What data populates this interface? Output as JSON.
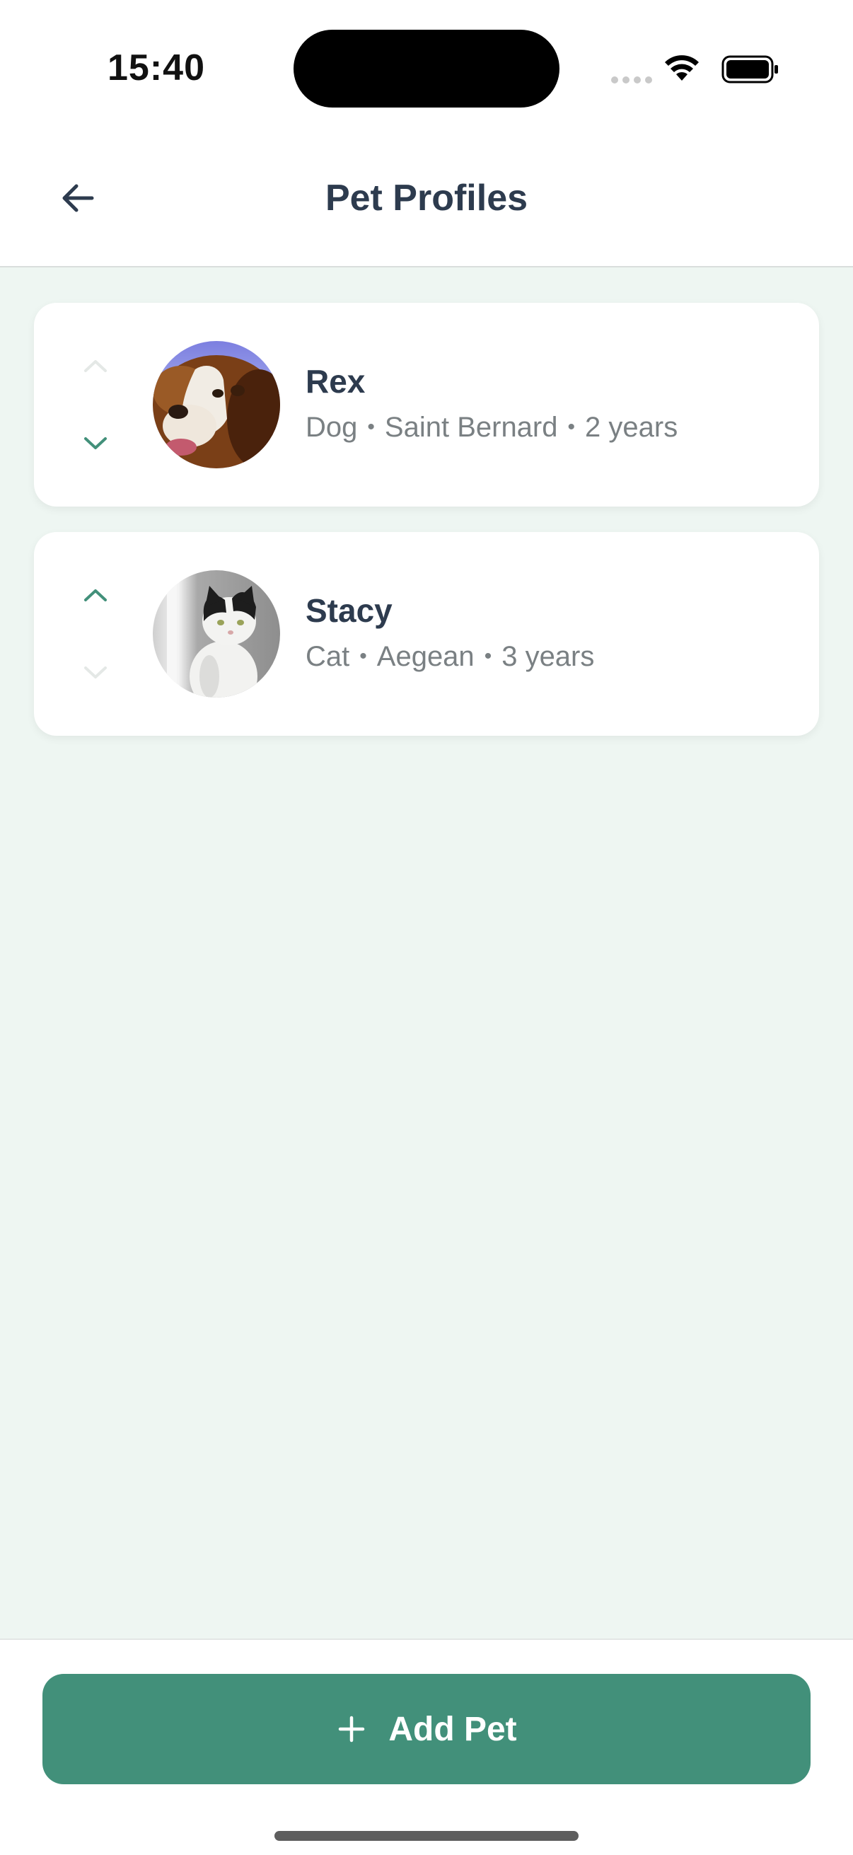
{
  "status_bar": {
    "time": "15:40"
  },
  "header": {
    "title": "Pet Profiles",
    "back_icon": "arrow-left-icon"
  },
  "pets": [
    {
      "name": "Rex",
      "species": "Dog",
      "breed": "Saint Bernard",
      "age": "2 years",
      "separator": "•",
      "avatar": "dog-photo",
      "move_up_enabled": false,
      "move_down_enabled": true
    },
    {
      "name": "Stacy",
      "species": "Cat",
      "breed": "Aegean",
      "age": "3 years",
      "separator": "•",
      "avatar": "cat-photo",
      "move_up_enabled": true,
      "move_down_enabled": false
    }
  ],
  "footer": {
    "add_button_label": "Add Pet",
    "add_icon": "plus-icon"
  },
  "colors": {
    "accent": "#42907a",
    "background": "#eef6f2",
    "title_text": "#2d3b4e",
    "secondary_text": "#7a8083",
    "disabled_chevron": "#e4e8e6"
  }
}
